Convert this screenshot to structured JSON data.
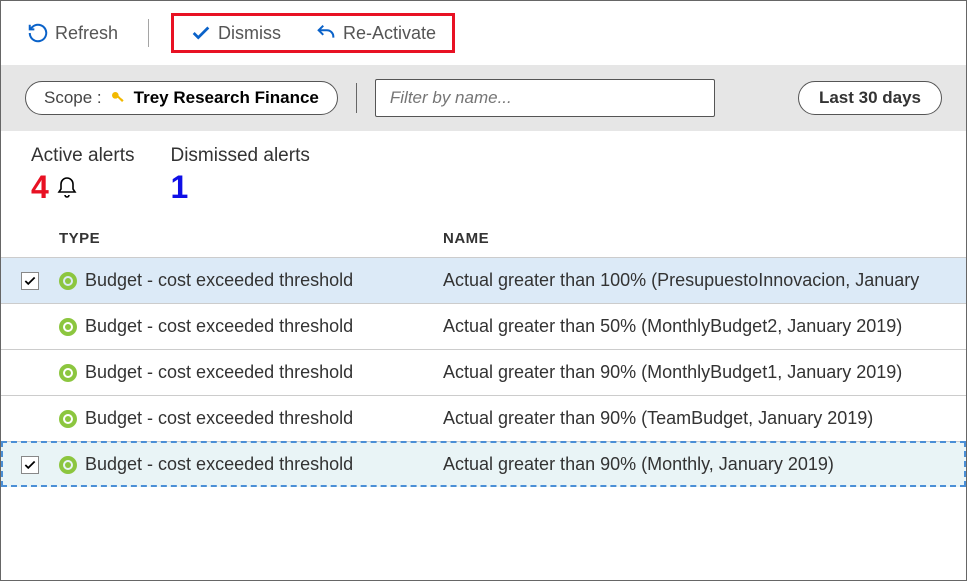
{
  "toolbar": {
    "refresh_label": "Refresh",
    "dismiss_label": "Dismiss",
    "reactivate_label": "Re-Activate"
  },
  "filter": {
    "scope_prefix": "Scope :",
    "scope_value": "Trey Research Finance",
    "filter_placeholder": "Filter by name...",
    "daterange_label": "Last 30 days"
  },
  "stats": {
    "active_label": "Active alerts",
    "active_count": "4",
    "dismissed_label": "Dismissed alerts",
    "dismissed_count": "1"
  },
  "columns": {
    "type": "TYPE",
    "name": "NAME"
  },
  "rows": [
    {
      "selected": true,
      "dashed": false,
      "type": "Budget - cost exceeded threshold",
      "name": "Actual greater than 100% (PresupuestoInnovacion, January "
    },
    {
      "selected": false,
      "dashed": false,
      "type": "Budget - cost exceeded threshold",
      "name": "Actual greater than 50% (MonthlyBudget2, January 2019)"
    },
    {
      "selected": false,
      "dashed": false,
      "type": "Budget - cost exceeded threshold",
      "name": "Actual greater than 90% (MonthlyBudget1, January 2019)"
    },
    {
      "selected": false,
      "dashed": false,
      "type": "Budget - cost exceeded threshold",
      "name": "Actual greater than 90% (TeamBudget, January 2019)"
    },
    {
      "selected": true,
      "dashed": true,
      "type": "Budget - cost exceeded threshold",
      "name": "Actual greater than 90% (Monthly, January 2019)"
    }
  ]
}
